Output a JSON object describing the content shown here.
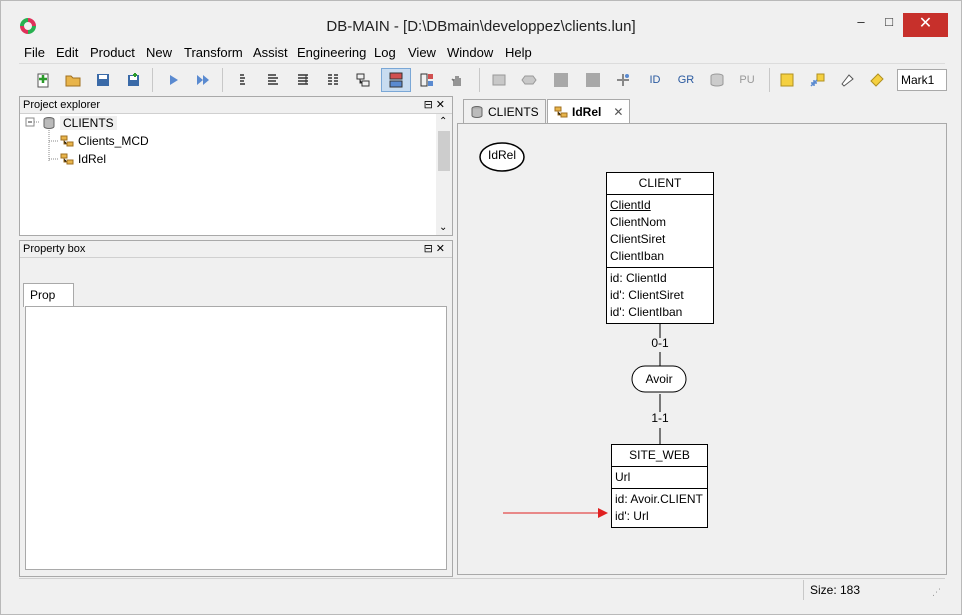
{
  "app": {
    "title": "DB-MAIN  - [D:\\DBmain\\developpez\\clients.lun]",
    "minimize": "–",
    "maximize": "□",
    "close": "✕"
  },
  "menu": [
    "File",
    "Edit",
    "Product",
    "New",
    "Transform",
    "Assist",
    "Engineering",
    "Log",
    "View",
    "Window",
    "Help"
  ],
  "toolbar": {
    "id_label": "ID",
    "gr_label": "GR",
    "pu_label": "PU",
    "mark_value": "Mark1"
  },
  "project_explorer": {
    "title": "Project explorer",
    "root": "CLIENTS",
    "children": [
      "Clients_MCD",
      "IdRel"
    ]
  },
  "property_box": {
    "title": "Property box",
    "tab": "Prop"
  },
  "doc_tabs": {
    "tab1": "CLIENTS",
    "tab2": "IdRel"
  },
  "diagram": {
    "schema_label": "IdRel",
    "client": {
      "name": "CLIENT",
      "attributes": [
        "ClientId",
        "ClientNom",
        "ClientSiret",
        "ClientIban"
      ],
      "identifiers": [
        "id: ClientId",
        "id': ClientSiret",
        "id': ClientIban"
      ]
    },
    "relationship": "Avoir",
    "card_top": "0-1",
    "card_bottom": "1-1",
    "site_web": {
      "name": "SITE_WEB",
      "attributes": [
        "Url"
      ],
      "identifiers": [
        "id: Avoir.CLIENT",
        "id': Url"
      ]
    },
    "arrow_color": "#e02020"
  },
  "status": {
    "size": "Size: 183"
  }
}
